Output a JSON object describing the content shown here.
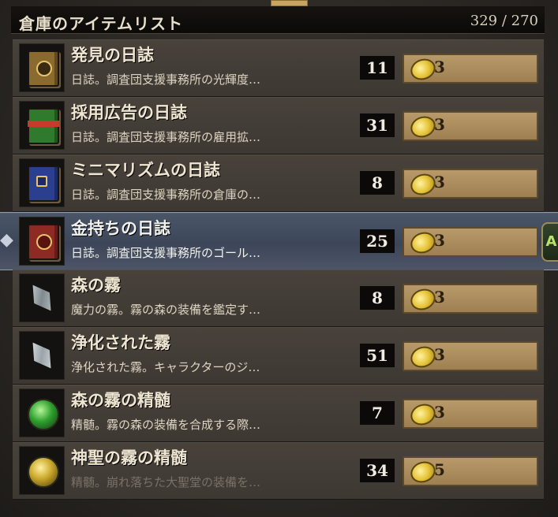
{
  "header": {
    "title": "倉庫のアイテムリスト",
    "count": "329 / 270"
  },
  "colors": {
    "row_bg": "#48423b",
    "selected_bg": "#4a5668",
    "price_bg": "#b89a6a",
    "qty_bg": "#0b0a09"
  },
  "items": [
    {
      "name": "発見の日誌",
      "desc": "日誌。調査団支援事務所の光輝度…",
      "qty": "11",
      "price": "3",
      "icon": "yellow-journal-icon",
      "color": "#8a6a2e"
    },
    {
      "name": "採用広告の日誌",
      "desc": "日誌。調査団支援事務所の雇用拡…",
      "qty": "31",
      "price": "3",
      "icon": "green-journal-icon",
      "color": "#2f7a2c"
    },
    {
      "name": "ミニマリズムの日誌",
      "desc": "日誌。調査団支援事務所の倉庫の…",
      "qty": "8",
      "price": "3",
      "icon": "blue-journal-icon",
      "color": "#2a3f8e"
    },
    {
      "name": "金持ちの日誌",
      "desc": "日誌。調査団支援事務所のゴール…",
      "qty": "25",
      "price": "3",
      "icon": "red-journal-icon",
      "color": "#8e2a24"
    },
    {
      "name": "森の霧",
      "desc": "魔力の霧。霧の森の装備を鑑定す…",
      "qty": "8",
      "price": "3",
      "icon": "mist-crystal-icon"
    },
    {
      "name": "浄化された霧",
      "desc": "浄化された霧。キャラクターのジ…",
      "qty": "51",
      "price": "3",
      "icon": "purified-mist-crystal-icon"
    },
    {
      "name": "森の霧の精髄",
      "desc": "精髄。霧の森の装備を合成する際…",
      "qty": "7",
      "price": "3",
      "icon": "green-essence-orb-icon",
      "color": "#2fa12f"
    },
    {
      "name": "神聖の霧の精髄",
      "desc": "精髄。崩れ落ちた大聖堂の装備を…",
      "qty": "34",
      "price": "5",
      "icon": "gold-essence-orb-icon",
      "color": "#c9a62a"
    }
  ],
  "selected_action": "A"
}
